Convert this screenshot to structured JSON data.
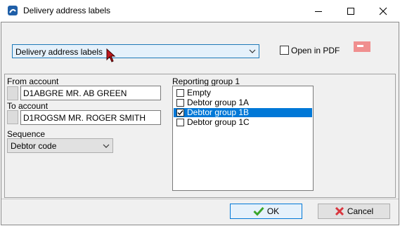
{
  "window": {
    "title": "Delivery address labels"
  },
  "report": {
    "selected": "Delivery address labels"
  },
  "pdf": {
    "label": "Open in PDF",
    "checked": false
  },
  "from_account": {
    "label": "From account",
    "value": "D1ABGRE MR. AB GREEN"
  },
  "to_account": {
    "label": "To account",
    "value": "D1ROGSM MR. ROGER SMITH"
  },
  "sequence": {
    "label": "Sequence",
    "value": "Debtor code"
  },
  "reporting_group": {
    "label": "Reporting group 1",
    "items": [
      {
        "label": "Empty",
        "checked": false,
        "selected": false
      },
      {
        "label": "Debtor group 1A",
        "checked": false,
        "selected": false
      },
      {
        "label": "Debtor group 1B",
        "checked": true,
        "selected": true
      },
      {
        "label": "Debtor group 1C",
        "checked": false,
        "selected": false
      }
    ]
  },
  "buttons": {
    "ok": "OK",
    "cancel": "Cancel"
  },
  "colors": {
    "selection": "#0078d7",
    "ok_check": "#3aa52a",
    "cancel_x": "#d9363e",
    "pdf_icon": "#f08f8f"
  }
}
